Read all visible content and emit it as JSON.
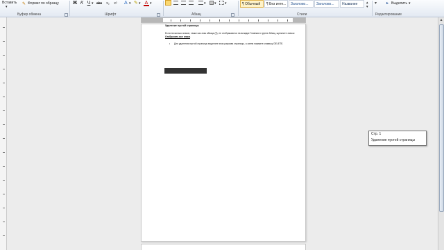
{
  "ribbon": {
    "clipboard": {
      "paste_label": "Вставить",
      "format_painter_label": "Формат по образцу",
      "group_label": "Буфер обмена"
    },
    "font": {
      "group_label": "Шрифт",
      "bold": "Ж",
      "italic": "К",
      "underline": "Ч",
      "strike": "abc",
      "subscript": "x₂",
      "superscript": "x²",
      "font_color": "A"
    },
    "paragraph": {
      "group_label": "Абзац"
    },
    "styles": {
      "group_label": "Стили",
      "items": [
        "¶ Обычный",
        "¶ Без инте...",
        "Заголово...",
        "Заголово...",
        "Название"
      ]
    },
    "editing": {
      "select_label": "Выделить",
      "group_label": "Редактирование"
    }
  },
  "document": {
    "title": "Удаление пустой страницы",
    "paragraph1": "Если несколько знаков, также как знак абзаца (¶), не отображаются на вкладке Главная в группе Абзац, щелкните значок ",
    "paragraph1_link": "Отобразить все знаки",
    "bullet": "Для удаления пустой страницы выделите знак разрыва страницы, а затем нажмите клавишу DELETE."
  },
  "tooltip": {
    "page": "Стр. 1",
    "heading": "Удаление пустой страницы"
  },
  "colors": {
    "accent": "#2b579a",
    "active_style": "#fff3c9",
    "page_bg": "#ffffff",
    "workspace_bg": "#ececec"
  }
}
